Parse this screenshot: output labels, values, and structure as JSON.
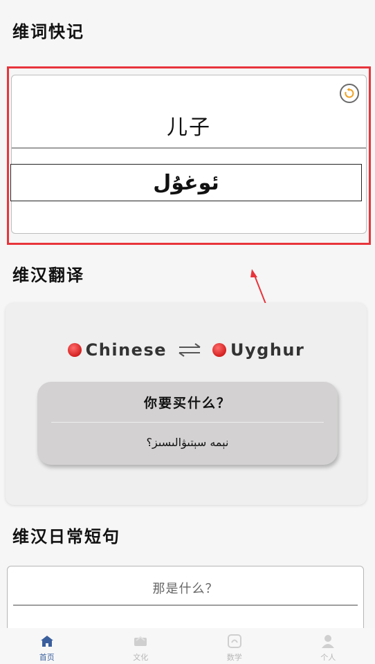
{
  "sections": {
    "word_flash_title": "维词快记",
    "translate_title": "维汉翻译",
    "daily_phrases_title": "维汉日常短句"
  },
  "word_card": {
    "chinese": "儿子",
    "uyghur": "ئوغۇل",
    "refresh_icon": "refresh-icon"
  },
  "translator": {
    "source_lang": "Chinese",
    "target_lang": "Uyghur",
    "swap_icon": "swap-arrows-icon",
    "result_chinese": "你要买什么？",
    "result_uyghur": "نېمە سېتىۋالىسىز؟"
  },
  "phrase_card": {
    "chinese": "那是什么？"
  },
  "bottom_nav": {
    "items": [
      {
        "label": "首页",
        "icon": "home-icon",
        "active": true
      },
      {
        "label": "文化",
        "icon": "culture-icon",
        "active": false
      },
      {
        "label": "数学",
        "icon": "math-icon",
        "active": false
      },
      {
        "label": "个人",
        "icon": "person-icon",
        "active": false
      }
    ]
  },
  "colors": {
    "highlight_frame": "#e8343b",
    "nav_active": "#3a5f9c",
    "nav_inactive": "#b7b7b7",
    "refresh_accent": "#f0a020"
  }
}
